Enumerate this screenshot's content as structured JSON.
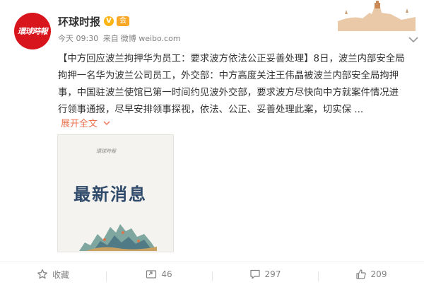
{
  "user": {
    "name": "环球时报",
    "avatar_text": "環球時報",
    "verified_mark": "V",
    "badge_text": "会"
  },
  "post": {
    "time": "今天 09:30",
    "source_prefix": "来自",
    "source": "微博 weibo.com",
    "text": "【中方回应波兰拘押华为员工：要求波方依法公正妥善处理】8日，波兰内部安全局拘押一名华为波兰公司员工，外交部：中方高度关注王伟晶被波兰内部安全局拘押事，中国驻波兰使馆已第一时间约见波外交部，要求波方尽快向中方就案件情况进行领事通报，尽早安排领事探视，依法、公正、妥善处理此案，切实保 ...",
    "expand_label": "展开全文"
  },
  "image": {
    "logo_text": "環球時報",
    "title": "最新消息"
  },
  "actions": {
    "favorite_label": "收藏",
    "repost_count": "46",
    "comment_count": "297",
    "like_count": "209"
  },
  "icons": {
    "favorite": "star-icon",
    "repost": "repost-icon",
    "comment": "comment-icon",
    "like": "thumbs-up-icon",
    "verified": "verified-icon",
    "menu": "chevron-down-icon"
  },
  "colors": {
    "avatar_bg": "#d8141c",
    "link": "#eb7350",
    "text": "#333333",
    "meta": "#808080",
    "verified": "#fdb515"
  }
}
